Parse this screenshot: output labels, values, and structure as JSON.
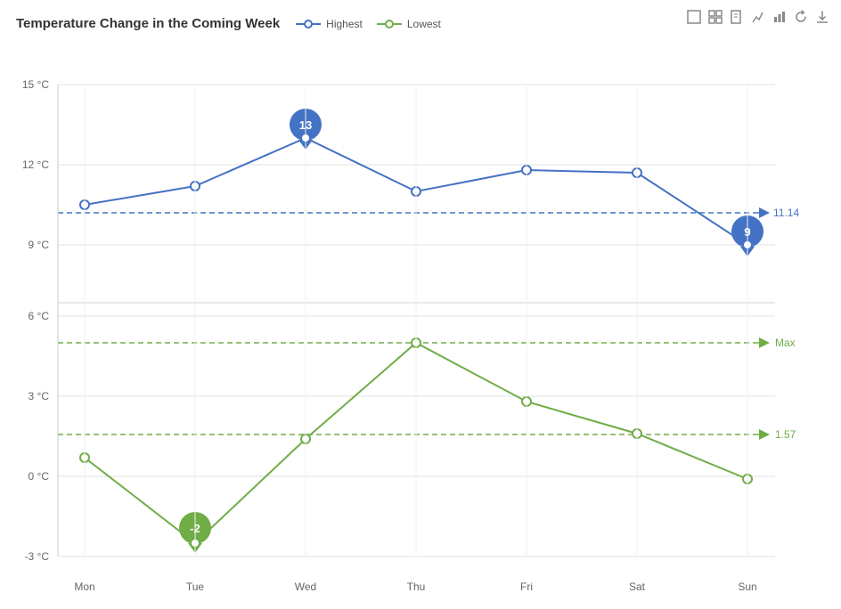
{
  "title": "Temperature Change in the Coming Week",
  "legend": {
    "highest_label": "Highest",
    "lowest_label": "Lowest"
  },
  "toolbar": {
    "icons": [
      "⬜",
      "⬜",
      "🗋",
      "📈",
      "📊",
      "↺",
      "⬇"
    ]
  },
  "chart": {
    "days": [
      "Mon",
      "Tue",
      "Wed",
      "Thu",
      "Fri",
      "Sat",
      "Sun"
    ],
    "highest": [
      10.5,
      11.2,
      13,
      11,
      11.8,
      11.7,
      9
    ],
    "lowest": [
      0.7,
      -2.5,
      1.4,
      5.0,
      2.8,
      1.6,
      -0.1
    ],
    "highest_avg": 11.14,
    "lowest_avg": 1.57,
    "lowest_max_label": "Max",
    "highest_avg_label": "11.14",
    "lowest_avg_label": "1.57",
    "highest_min_label": "13",
    "lowest_min_label": "-2",
    "highest_last_label": "9"
  }
}
